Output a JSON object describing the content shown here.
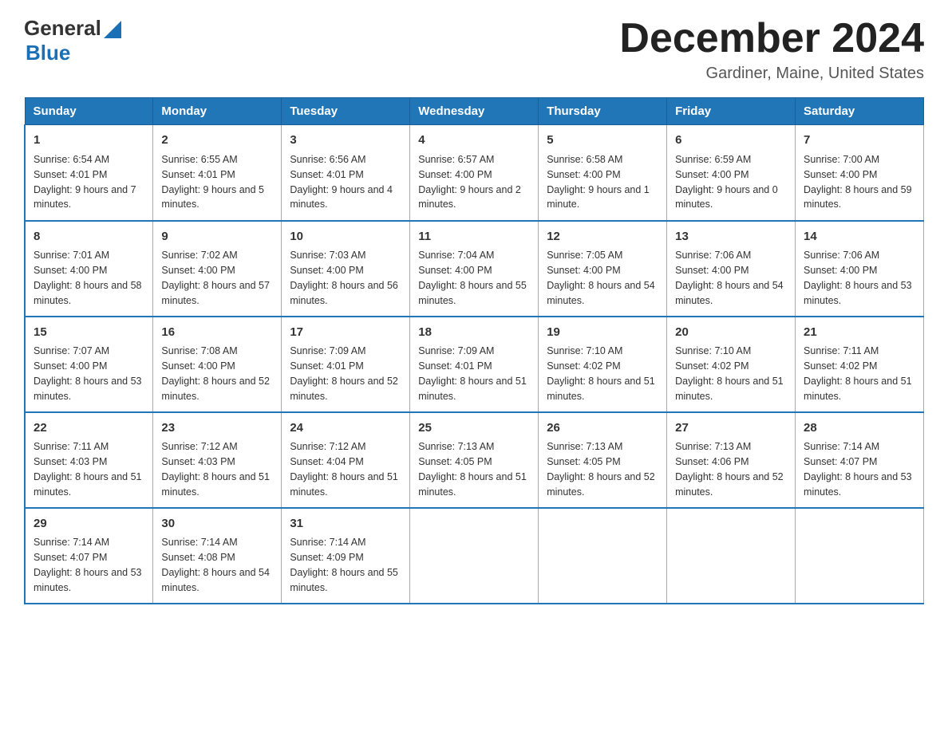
{
  "logo": {
    "general": "General",
    "blue": "Blue"
  },
  "title": "December 2024",
  "location": "Gardiner, Maine, United States",
  "weekdays": [
    "Sunday",
    "Monday",
    "Tuesday",
    "Wednesday",
    "Thursday",
    "Friday",
    "Saturday"
  ],
  "weeks": [
    [
      {
        "day": 1,
        "sunrise": "6:54 AM",
        "sunset": "4:01 PM",
        "daylight": "9 hours and 7 minutes."
      },
      {
        "day": 2,
        "sunrise": "6:55 AM",
        "sunset": "4:01 PM",
        "daylight": "9 hours and 5 minutes."
      },
      {
        "day": 3,
        "sunrise": "6:56 AM",
        "sunset": "4:01 PM",
        "daylight": "9 hours and 4 minutes."
      },
      {
        "day": 4,
        "sunrise": "6:57 AM",
        "sunset": "4:00 PM",
        "daylight": "9 hours and 2 minutes."
      },
      {
        "day": 5,
        "sunrise": "6:58 AM",
        "sunset": "4:00 PM",
        "daylight": "9 hours and 1 minute."
      },
      {
        "day": 6,
        "sunrise": "6:59 AM",
        "sunset": "4:00 PM",
        "daylight": "9 hours and 0 minutes."
      },
      {
        "day": 7,
        "sunrise": "7:00 AM",
        "sunset": "4:00 PM",
        "daylight": "8 hours and 59 minutes."
      }
    ],
    [
      {
        "day": 8,
        "sunrise": "7:01 AM",
        "sunset": "4:00 PM",
        "daylight": "8 hours and 58 minutes."
      },
      {
        "day": 9,
        "sunrise": "7:02 AM",
        "sunset": "4:00 PM",
        "daylight": "8 hours and 57 minutes."
      },
      {
        "day": 10,
        "sunrise": "7:03 AM",
        "sunset": "4:00 PM",
        "daylight": "8 hours and 56 minutes."
      },
      {
        "day": 11,
        "sunrise": "7:04 AM",
        "sunset": "4:00 PM",
        "daylight": "8 hours and 55 minutes."
      },
      {
        "day": 12,
        "sunrise": "7:05 AM",
        "sunset": "4:00 PM",
        "daylight": "8 hours and 54 minutes."
      },
      {
        "day": 13,
        "sunrise": "7:06 AM",
        "sunset": "4:00 PM",
        "daylight": "8 hours and 54 minutes."
      },
      {
        "day": 14,
        "sunrise": "7:06 AM",
        "sunset": "4:00 PM",
        "daylight": "8 hours and 53 minutes."
      }
    ],
    [
      {
        "day": 15,
        "sunrise": "7:07 AM",
        "sunset": "4:00 PM",
        "daylight": "8 hours and 53 minutes."
      },
      {
        "day": 16,
        "sunrise": "7:08 AM",
        "sunset": "4:00 PM",
        "daylight": "8 hours and 52 minutes."
      },
      {
        "day": 17,
        "sunrise": "7:09 AM",
        "sunset": "4:01 PM",
        "daylight": "8 hours and 52 minutes."
      },
      {
        "day": 18,
        "sunrise": "7:09 AM",
        "sunset": "4:01 PM",
        "daylight": "8 hours and 51 minutes."
      },
      {
        "day": 19,
        "sunrise": "7:10 AM",
        "sunset": "4:02 PM",
        "daylight": "8 hours and 51 minutes."
      },
      {
        "day": 20,
        "sunrise": "7:10 AM",
        "sunset": "4:02 PM",
        "daylight": "8 hours and 51 minutes."
      },
      {
        "day": 21,
        "sunrise": "7:11 AM",
        "sunset": "4:02 PM",
        "daylight": "8 hours and 51 minutes."
      }
    ],
    [
      {
        "day": 22,
        "sunrise": "7:11 AM",
        "sunset": "4:03 PM",
        "daylight": "8 hours and 51 minutes."
      },
      {
        "day": 23,
        "sunrise": "7:12 AM",
        "sunset": "4:03 PM",
        "daylight": "8 hours and 51 minutes."
      },
      {
        "day": 24,
        "sunrise": "7:12 AM",
        "sunset": "4:04 PM",
        "daylight": "8 hours and 51 minutes."
      },
      {
        "day": 25,
        "sunrise": "7:13 AM",
        "sunset": "4:05 PM",
        "daylight": "8 hours and 51 minutes."
      },
      {
        "day": 26,
        "sunrise": "7:13 AM",
        "sunset": "4:05 PM",
        "daylight": "8 hours and 52 minutes."
      },
      {
        "day": 27,
        "sunrise": "7:13 AM",
        "sunset": "4:06 PM",
        "daylight": "8 hours and 52 minutes."
      },
      {
        "day": 28,
        "sunrise": "7:14 AM",
        "sunset": "4:07 PM",
        "daylight": "8 hours and 53 minutes."
      }
    ],
    [
      {
        "day": 29,
        "sunrise": "7:14 AM",
        "sunset": "4:07 PM",
        "daylight": "8 hours and 53 minutes."
      },
      {
        "day": 30,
        "sunrise": "7:14 AM",
        "sunset": "4:08 PM",
        "daylight": "8 hours and 54 minutes."
      },
      {
        "day": 31,
        "sunrise": "7:14 AM",
        "sunset": "4:09 PM",
        "daylight": "8 hours and 55 minutes."
      },
      null,
      null,
      null,
      null
    ]
  ]
}
